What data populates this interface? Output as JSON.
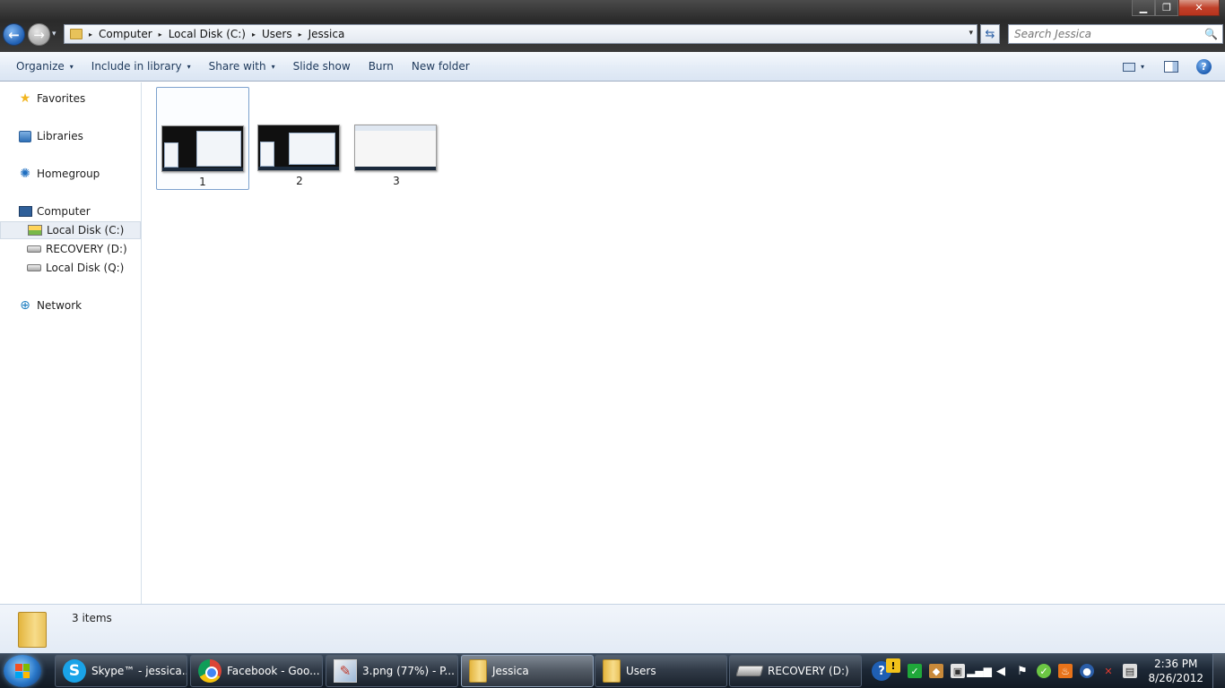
{
  "window": {
    "controls": {
      "minimize": "▁",
      "maximize": "❐",
      "close": "✕"
    }
  },
  "navigation": {
    "back": "←",
    "forward": "→",
    "recent": "▾"
  },
  "address": {
    "breadcrumbs": [
      "Computer",
      "Local Disk (C:)",
      "Users",
      "Jessica"
    ],
    "separator": "▸",
    "dropdown": "▾",
    "refresh": "⇆"
  },
  "search": {
    "placeholder": "Search Jessica",
    "icon": "🔍"
  },
  "toolbar": {
    "organize": "Organize",
    "include_in_library": "Include in library",
    "share_with": "Share with",
    "slide_show": "Slide show",
    "burn": "Burn",
    "new_folder": "New folder",
    "dropdown": "▾",
    "help": "?"
  },
  "sidebar": {
    "favorites": "Favorites",
    "libraries": "Libraries",
    "homegroup": "Homegroup",
    "computer": "Computer",
    "drives": [
      "Local Disk (C:)",
      "RECOVERY (D:)",
      "Local Disk (Q:)"
    ],
    "network": "Network"
  },
  "files": [
    {
      "name": "1"
    },
    {
      "name": "2"
    },
    {
      "name": "3"
    }
  ],
  "details": {
    "count": "3 items"
  },
  "taskbar": {
    "tasks": [
      {
        "label": "Skype™ - jessica...",
        "icon": "skype-icon"
      },
      {
        "label": "Facebook - Goo...",
        "icon": "chrome-icon"
      },
      {
        "label": "3.png (77%) - P...",
        "icon": "paint-icon"
      },
      {
        "label": "Jessica",
        "icon": "folder-icon"
      },
      {
        "label": "Users",
        "icon": "folder-icon"
      },
      {
        "label": "RECOVERY (D:)",
        "icon": "drive-icon"
      }
    ],
    "tray": {
      "help_glyph": "?",
      "alert_glyph": "!"
    },
    "clock": {
      "time": "2:36 PM",
      "date": "8/26/2012"
    }
  },
  "colors": {
    "accent": "#1e395b",
    "selection": "#7da2ce",
    "taskbar": "#1d2836"
  }
}
